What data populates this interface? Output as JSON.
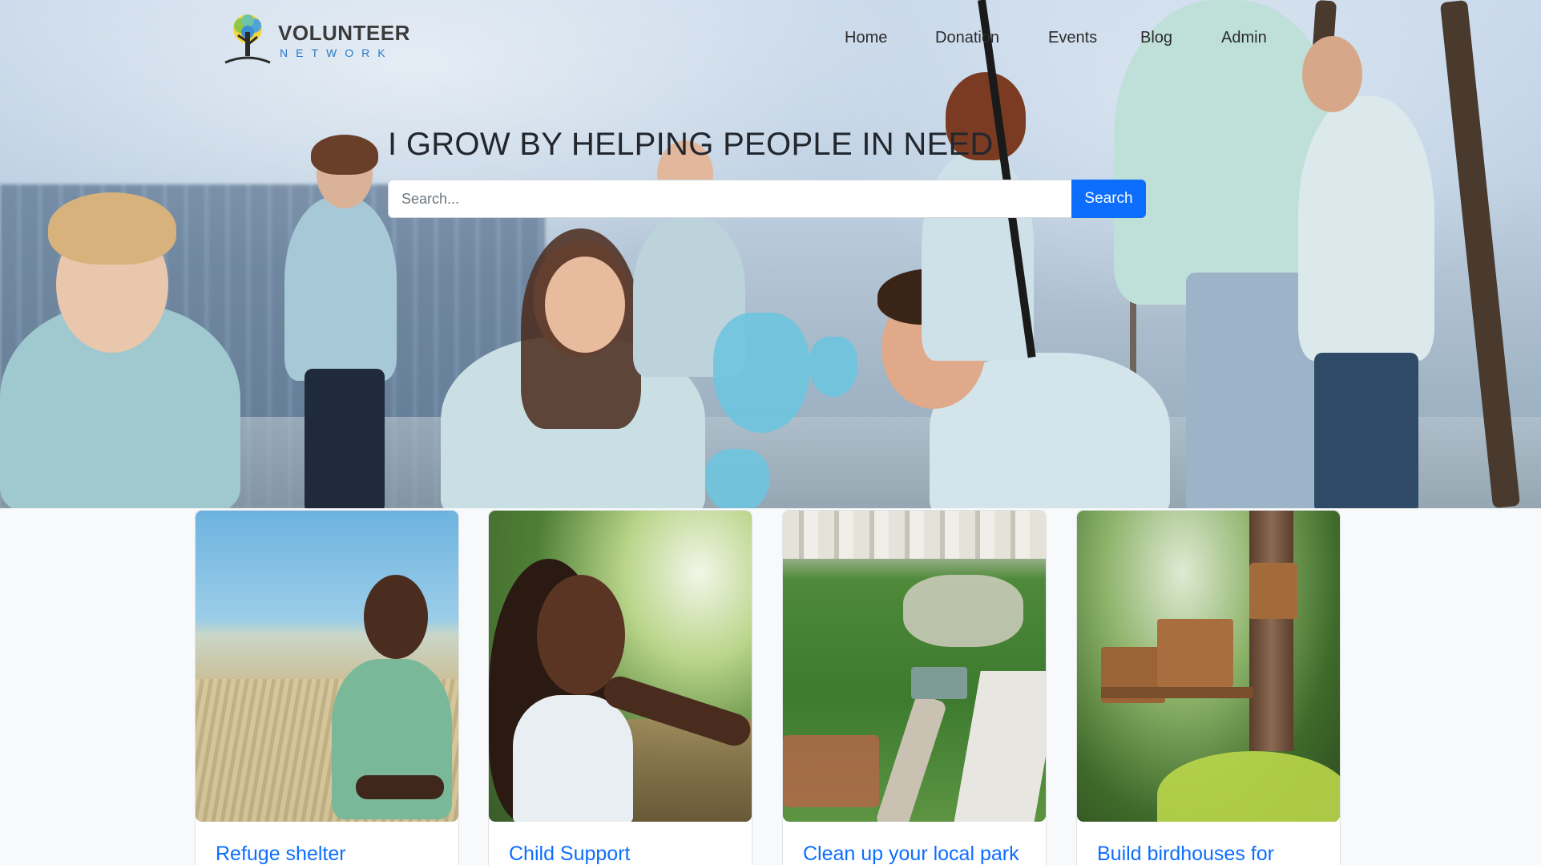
{
  "brand": {
    "title": "VOLUNTEER",
    "subtitle": "NETWORK"
  },
  "nav": {
    "items": [
      {
        "label": "Home"
      },
      {
        "label": "Donation"
      },
      {
        "label": "Events"
      },
      {
        "label": "Blog"
      },
      {
        "label": "Admin"
      }
    ]
  },
  "hero": {
    "headline": "I GROW BY HELPING PEOPLE IN NEED",
    "search": {
      "placeholder": "Search...",
      "value": "",
      "button_label": "Search"
    }
  },
  "cards": [
    {
      "title": "Refuge shelter",
      "image": "boy-in-field-photo"
    },
    {
      "title": "Child Support",
      "image": "girl-smiling-photo"
    },
    {
      "title": "Clean up your local park",
      "image": "city-park-aerial-photo"
    },
    {
      "title": "Build birdhouses for",
      "image": "birdhouses-on-tree-photo"
    }
  ],
  "colors": {
    "accent": "#0d6efd",
    "page_bg": "#f8f9fa",
    "logo_blue": "#2a7ac4"
  }
}
